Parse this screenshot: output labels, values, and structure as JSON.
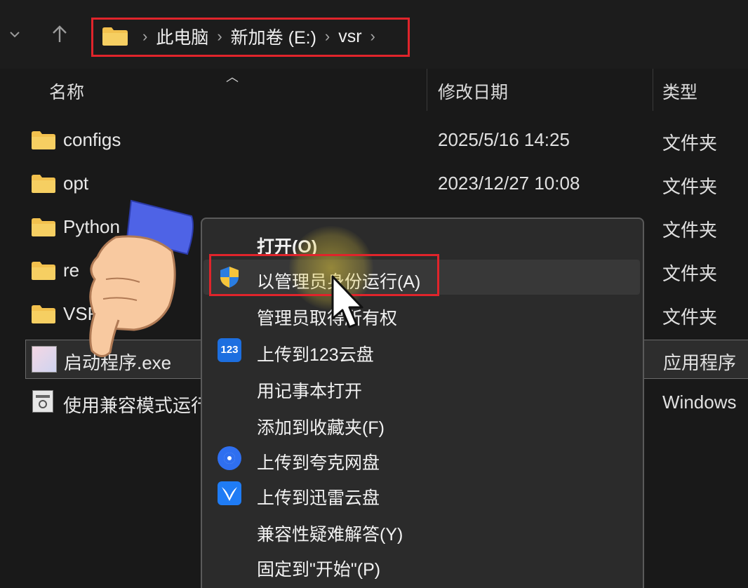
{
  "breadcrumb": {
    "items": [
      "此电脑",
      "新加卷 (E:)",
      "vsr"
    ]
  },
  "columns": {
    "name": "名称",
    "date": "修改日期",
    "type": "类型"
  },
  "files": [
    {
      "name": "configs",
      "date": "2025/5/16 14:25",
      "type": "文件夹"
    },
    {
      "name": "opt",
      "date": "2023/12/27 10:08",
      "type": "文件夹"
    },
    {
      "name": "Python",
      "date": "",
      "type": "文件夹"
    },
    {
      "name": "re",
      "date": "",
      "type": "文件夹"
    },
    {
      "name": "VSR",
      "date": "",
      "type": "文件夹"
    },
    {
      "name": "启动程序.exe",
      "date": "",
      "type": "应用程序"
    },
    {
      "name": "使用兼容模式运行",
      "date": "",
      "type": "Windows"
    }
  ],
  "context_menu": {
    "items": [
      {
        "label": "打开(O)",
        "icon": ""
      },
      {
        "label": "以管理员身份运行(A)",
        "icon": "uac-shield-icon"
      },
      {
        "label": "管理员取得所有权",
        "icon": ""
      },
      {
        "label": "上传到123云盘",
        "icon": "123-cloud-icon",
        "icon_text": "123"
      },
      {
        "label": "用记事本打开",
        "icon": ""
      },
      {
        "label": "添加到收藏夹(F)",
        "icon": ""
      },
      {
        "label": "上传到夸克网盘",
        "icon": "quark-icon"
      },
      {
        "label": "上传到迅雷云盘",
        "icon": "xunlei-icon"
      },
      {
        "label": "兼容性疑难解答(Y)",
        "icon": ""
      },
      {
        "label": "固定到\"开始\"(P)",
        "icon": ""
      }
    ]
  },
  "colors": {
    "highlight_box": "#e0242b",
    "folder": "#f2c14e",
    "background": "#191919",
    "menu_bg": "#2b2b2b"
  }
}
